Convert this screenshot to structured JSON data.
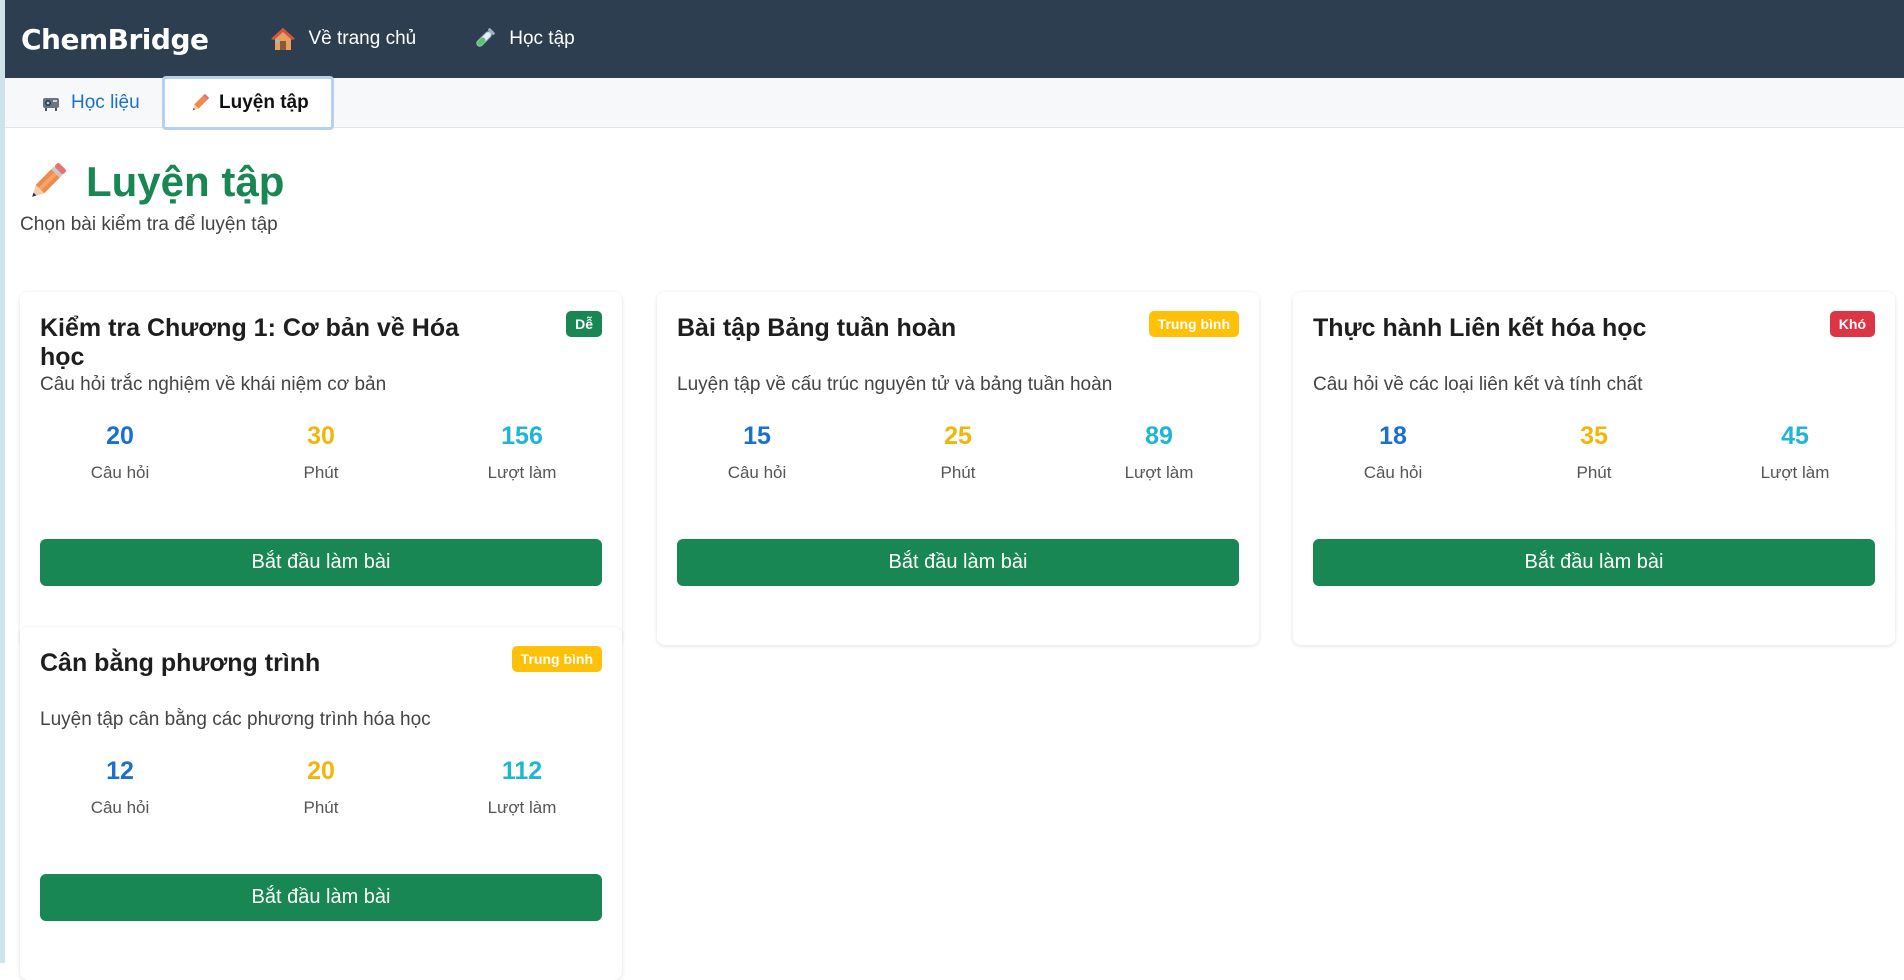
{
  "brand": "ChemBridge",
  "nav": {
    "home": "Về trang chủ",
    "learn": "Học tập"
  },
  "tabs": {
    "materials": "Học liệu",
    "practice": "Luyện tập"
  },
  "page": {
    "title": "Luyện tập",
    "subtitle": "Chọn bài kiểm tra để luyện tập"
  },
  "labels": {
    "questions": "Câu hỏi",
    "minutes": "Phút",
    "attempts": "Lượt làm",
    "start": "Bắt đầu làm bài"
  },
  "colors": {
    "nav_bg": "#2c3e50",
    "primary_green": "#198754",
    "easy": "#198754",
    "medium": "#ffc107",
    "hard": "#dc3545",
    "questions": "#1a6fd1",
    "minutes": "#f2b50a",
    "attempts": "#1fb6d6"
  },
  "quizzes": [
    {
      "title": "Kiểm tra Chương 1: Cơ bản về Hóa học",
      "difficulty": "Dễ",
      "description": "Câu hỏi trắc nghiệm về khái niệm cơ bản",
      "questions": "20",
      "minutes": "30",
      "attempts": "156"
    },
    {
      "title": "Bài tập Bảng tuần hoàn",
      "difficulty": "Trung bình",
      "description": "Luyện tập về cấu trúc nguyên tử và bảng tuần hoàn",
      "questions": "15",
      "minutes": "25",
      "attempts": "89"
    },
    {
      "title": "Thực hành Liên kết hóa học",
      "difficulty": "Khó",
      "description": "Câu hỏi về các loại liên kết và tính chất",
      "questions": "18",
      "minutes": "35",
      "attempts": "45"
    },
    {
      "title": "Cân bằng phương trình",
      "difficulty": "Trung bình",
      "description": "Luyện tập cân bằng các phương trình hóa học",
      "questions": "12",
      "minutes": "20",
      "attempts": "112"
    }
  ]
}
